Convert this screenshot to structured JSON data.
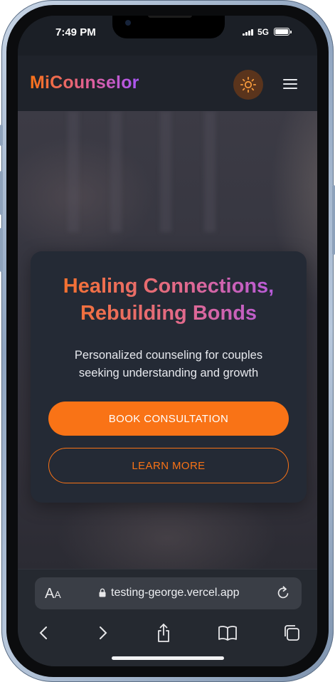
{
  "status_bar": {
    "time": "7:49 PM",
    "network": "5G"
  },
  "site": {
    "logo": "MiCounselor",
    "theme_toggle_icon": "sun-icon",
    "menu_icon": "hamburger-menu-icon",
    "accent_color": "#f97316",
    "gradient_end_color": "#a855f7"
  },
  "hero": {
    "title_line1": "Healing Connections,",
    "title_line2": "Rebuilding Bonds",
    "subtitle_line1": "Personalized counseling for couples",
    "subtitle_line2": "seeking understanding and growth",
    "primary_button": "BOOK CONSULTATION",
    "secondary_button": "LEARN MORE"
  },
  "browser": {
    "text_size_big": "A",
    "text_size_small": "A",
    "url": "testing-george.vercel.app",
    "icons": [
      "back-icon",
      "forward-icon",
      "share-icon",
      "bookmarks-icon",
      "tabs-icon"
    ]
  }
}
